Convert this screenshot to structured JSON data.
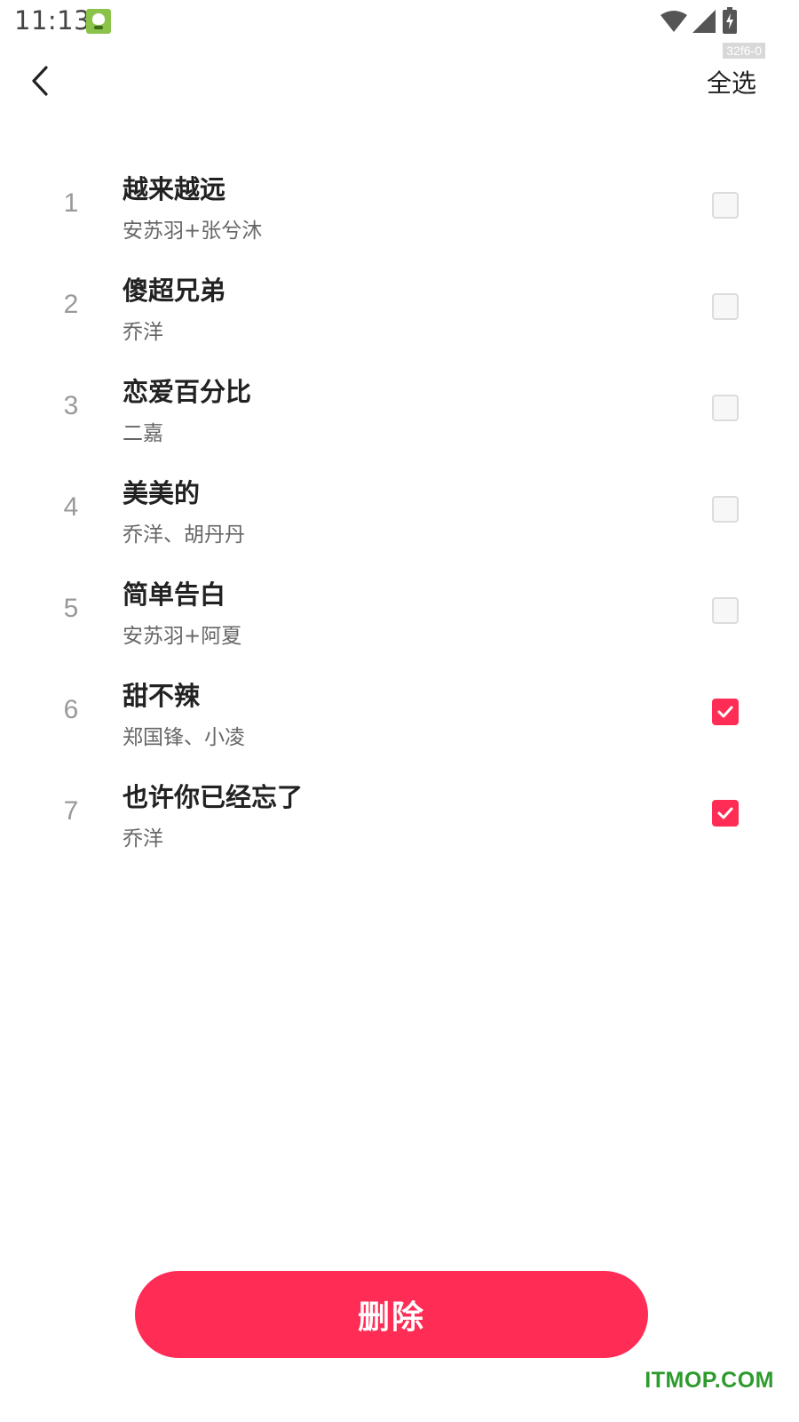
{
  "status_bar": {
    "time": "11:13",
    "app_icon": "android-app-icon",
    "icons": [
      "wifi-icon",
      "signal-icon",
      "battery-charging-icon"
    ],
    "debug_tag": "32f6-0"
  },
  "header": {
    "back_icon": "chevron-left-icon",
    "select_all_label": "全选"
  },
  "songs": [
    {
      "index": "1",
      "title": "越来越远",
      "artist": "安苏羽+张兮沐",
      "checked": false
    },
    {
      "index": "2",
      "title": "傻超兄弟",
      "artist": "乔洋",
      "checked": false
    },
    {
      "index": "3",
      "title": "恋爱百分比",
      "artist": "二嘉",
      "checked": false
    },
    {
      "index": "4",
      "title": "美美的",
      "artist": "乔洋、胡丹丹",
      "checked": false
    },
    {
      "index": "5",
      "title": "简单告白",
      "artist": "安苏羽+阿夏",
      "checked": false
    },
    {
      "index": "6",
      "title": "甜不辣",
      "artist": "郑国锋、小凌",
      "checked": true
    },
    {
      "index": "7",
      "title": "也许你已经忘了",
      "artist": "乔洋",
      "checked": true
    }
  ],
  "footer": {
    "delete_label": "删除"
  },
  "watermark": "ITMOP.COM",
  "colors": {
    "accent": "#ff2d55",
    "watermark": "#2e9b2e"
  }
}
